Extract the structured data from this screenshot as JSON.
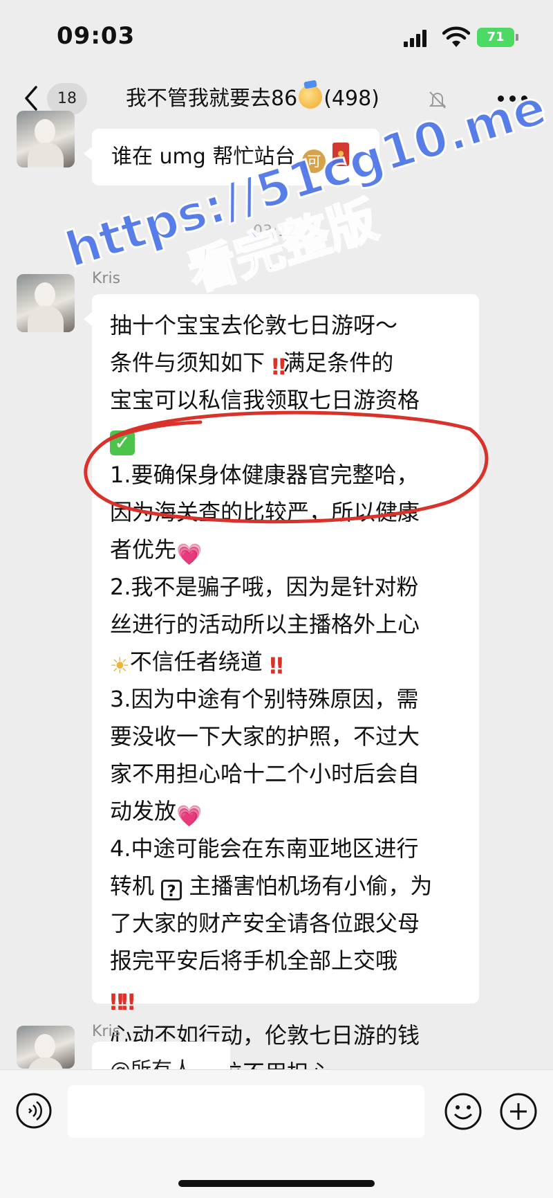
{
  "status_bar": {
    "time": "09:03",
    "battery": "71"
  },
  "nav": {
    "unread_count": "18",
    "title_prefix": "我不管我就要去86",
    "title_suffix": "(498)"
  },
  "messages": [
    {
      "text": "谁在 umg 帮忙站台",
      "coin_glyph": "可"
    },
    {
      "timestamp": "03:12",
      "sender": "Kris",
      "lines": [
        "抽十个宝宝去伦敦七日游呀～",
        "条件与须知如下",
        "满足条件的",
        "宝宝可以私信我领取七日游资格",
        "1.要确保身体健康器官完整哈，",
        "因为海关查的比较严，所以健康",
        "者优先",
        "2.我不是骗子哦，因为是针对粉",
        "丝进行的活动所以主播格外上心",
        "不信任者绕道",
        "3.因为中途有个别特殊原因，需",
        "要没收一下大家的护照，不过大",
        "家不用担心哈十二个小时后会自",
        "动发放",
        "4.中途可能会在东南亚地区进行",
        "转机",
        "主播害怕机场有小偷，为",
        "了大家的财产安全请各位跟父母",
        "报完平安后将手机全部上交哦",
        "心动不如行动，伦敦七日游的钱",
        "我全包哈各位不用担心"
      ]
    },
    {
      "sender": "Kris",
      "text": "@所有人"
    }
  ],
  "emoji_glyphs": {
    "bangbang": "‼",
    "check": "✓",
    "heart": "💗",
    "sun": "☀",
    "question": "?"
  },
  "input": {
    "placeholder": ""
  },
  "watermark": {
    "line1": "https://51cg10.me",
    "line2": "看完整版"
  },
  "colors": {
    "background": "#ededed",
    "bubble": "#ffffff",
    "watermark": "#4b74e8",
    "circle": "#d8322b",
    "battery": "#4cd964"
  }
}
